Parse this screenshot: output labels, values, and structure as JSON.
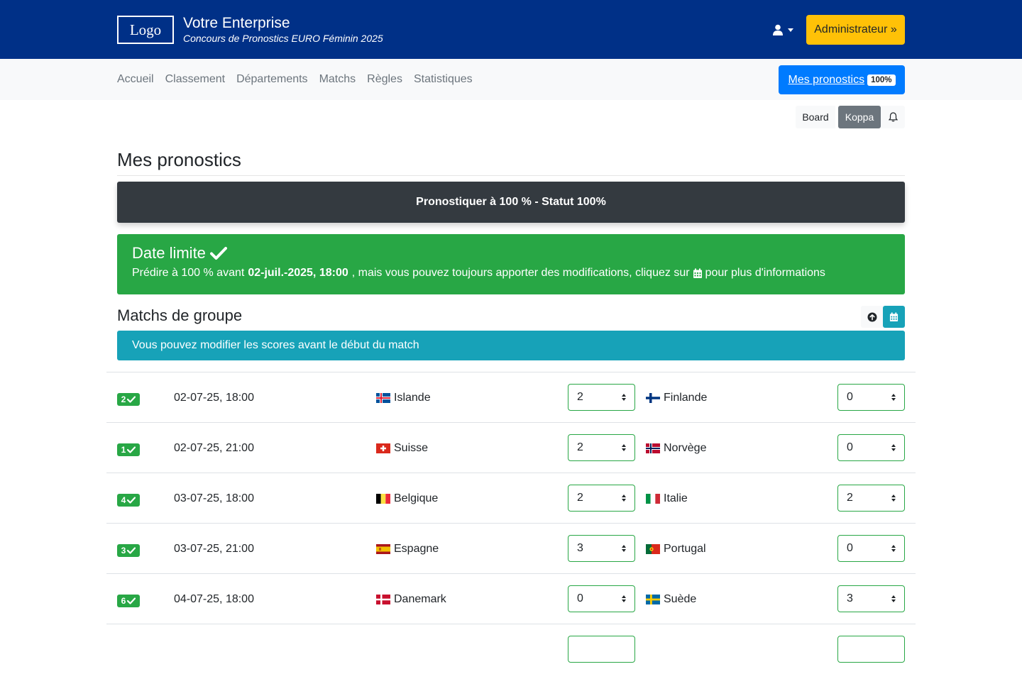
{
  "header": {
    "logo": "Logo",
    "company": "Votre Enterprise",
    "subtitle": "Concours de Pronostics EURO Féminin 2025",
    "admin_label": "Administrateur »"
  },
  "nav": {
    "items": [
      "Accueil",
      "Classement",
      "Départements",
      "Matchs",
      "Règles",
      "Statistiques"
    ],
    "my_predictions": "Mes pronostics",
    "my_predictions_badge": "100%"
  },
  "tools": {
    "board": "Board",
    "koppa": "Koppa"
  },
  "page": {
    "title": "Mes pronostics",
    "status": "Pronostiquer à 100 % - Statut 100%",
    "deadline_title": "Date limite",
    "deadline_prefix": "Prédire à 100 % avant",
    "deadline_date": "02-juil.-2025, 18:00",
    "deadline_suffix": ", mais vous pouvez toujours apporter des modifications, cliquez sur",
    "deadline_end": "pour plus d'informations",
    "group_title": "Matchs de groupe",
    "info": "Vous pouvez modifier les scores avant le début du match"
  },
  "matches": [
    {
      "badge": "2",
      "date": "02-07-25, 18:00",
      "home": "Islande",
      "home_score": "2",
      "away": "Finlande",
      "away_score": "0"
    },
    {
      "badge": "1",
      "date": "02-07-25, 21:00",
      "home": "Suisse",
      "home_score": "2",
      "away": "Norvège",
      "away_score": "0"
    },
    {
      "badge": "4",
      "date": "03-07-25, 18:00",
      "home": "Belgique",
      "home_score": "2",
      "away": "Italie",
      "away_score": "2"
    },
    {
      "badge": "3",
      "date": "03-07-25, 21:00",
      "home": "Espagne",
      "home_score": "3",
      "away": "Portugal",
      "away_score": "0"
    },
    {
      "badge": "6",
      "date": "04-07-25, 18:00",
      "home": "Danemark",
      "home_score": "0",
      "away": "Suède",
      "away_score": "3"
    }
  ],
  "colors": {
    "header_bg": "#003087",
    "accent_yellow": "#ffc107",
    "primary_blue": "#007bff",
    "success_green": "#28a745",
    "info_teal": "#17a2b8",
    "dark": "#343a40"
  }
}
